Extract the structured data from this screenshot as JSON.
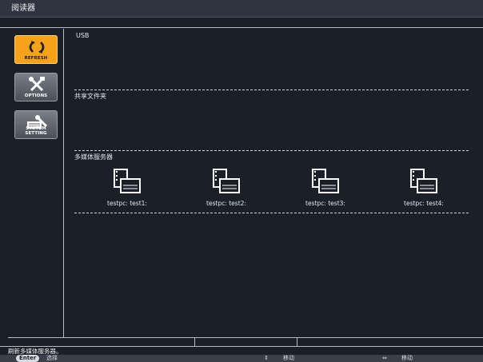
{
  "window": {
    "title": "阅读器"
  },
  "sidebar": {
    "items": [
      {
        "label": "REFRESH",
        "icon": "refresh-icon",
        "active": true
      },
      {
        "label": "OPTIONS",
        "icon": "tools-icon",
        "active": false
      },
      {
        "label": "SYSTEM SETTING",
        "icon": "keyboard-wrench-icon",
        "active": false
      }
    ]
  },
  "sections": {
    "usb": {
      "title": "USB"
    },
    "shared_folders": {
      "title": "共享文件夹"
    },
    "media_servers": {
      "title": "多媒体服务器",
      "items": [
        {
          "label": "testpc: test1:"
        },
        {
          "label": "testpc: test2:"
        },
        {
          "label": "testpc: test3:"
        },
        {
          "label": "testpc: test4:"
        }
      ]
    }
  },
  "status": {
    "message": "刷新多媒体服务器。"
  },
  "hints": {
    "enter_key": "Enter",
    "enter_action": "选择",
    "move_up_down": "移动",
    "move_left_right": "移动"
  },
  "colors": {
    "accent": "#f7a21b",
    "background": "#1b1f28"
  }
}
